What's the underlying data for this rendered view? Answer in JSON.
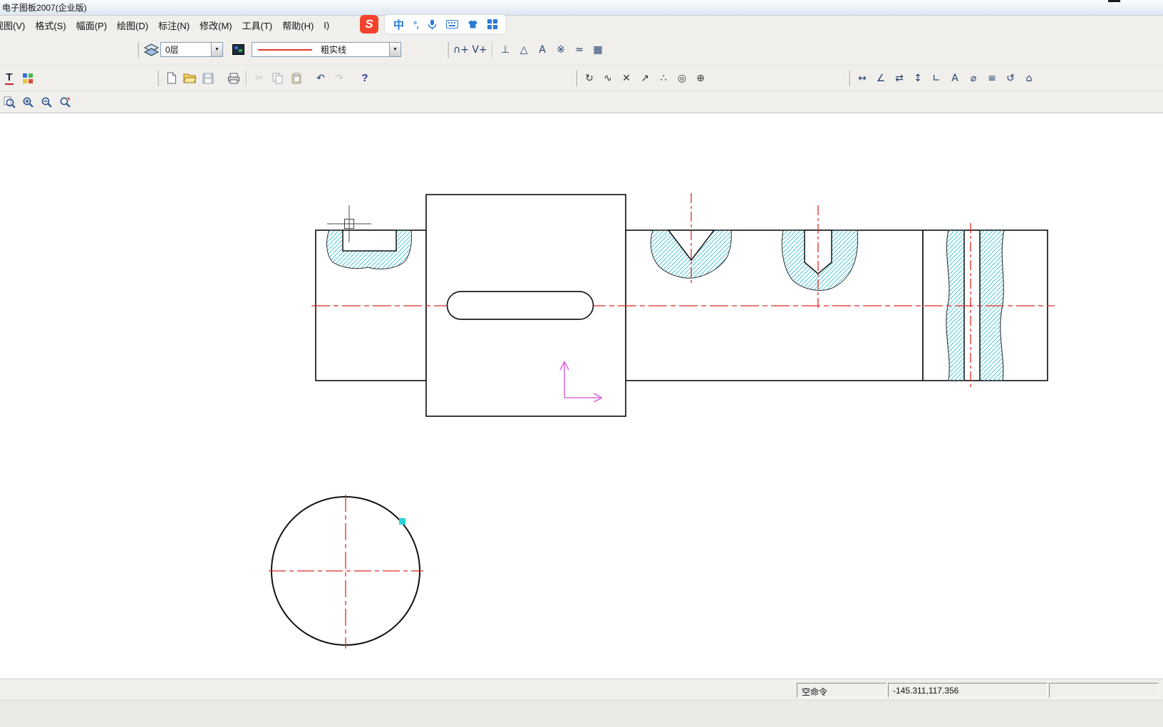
{
  "window": {
    "title": "电子图板2007(企业版)"
  },
  "menu": {
    "items": [
      "视图(V)",
      "格式(S)",
      "幅面(P)",
      "绘图(D)",
      "标注(N)",
      "修改(M)",
      "工具(T)",
      "帮助(H)",
      "I)"
    ]
  },
  "ime": {
    "logo_letter": "S",
    "mode_char": "中",
    "punct": "°,"
  },
  "format_toolbar": {
    "layer_value": "0层",
    "linestyle_value": "粗实线"
  },
  "icons": {
    "combo_arrow": "▼",
    "text_tool": "T",
    "cut": "✂",
    "undo": "↶",
    "redo": "↷",
    "help": "?",
    "format_tools": [
      "∩+",
      "V+",
      "⊥",
      "△",
      "A",
      "※",
      "≈",
      "▦"
    ],
    "draw_tools": [
      "↻",
      "∿",
      "✕",
      "↗",
      "∴",
      "◎",
      "⊕"
    ],
    "dim_tools": [
      "↔",
      "∠",
      "⇄",
      "↕",
      "∟",
      "A",
      "⌀",
      "≡",
      "↺",
      "⌂"
    ]
  },
  "statusbar": {
    "command": "空命令",
    "coordinates": "-145.311,117.356"
  },
  "colors": {
    "centerline_red": "#dd2b25",
    "hatch_cyan": "#49c6d8",
    "axes_magenta": "#da6ede",
    "grip_cyan": "#29d2d8",
    "sogou_red": "#f4432c",
    "ime_blue": "#2b7bd4"
  }
}
